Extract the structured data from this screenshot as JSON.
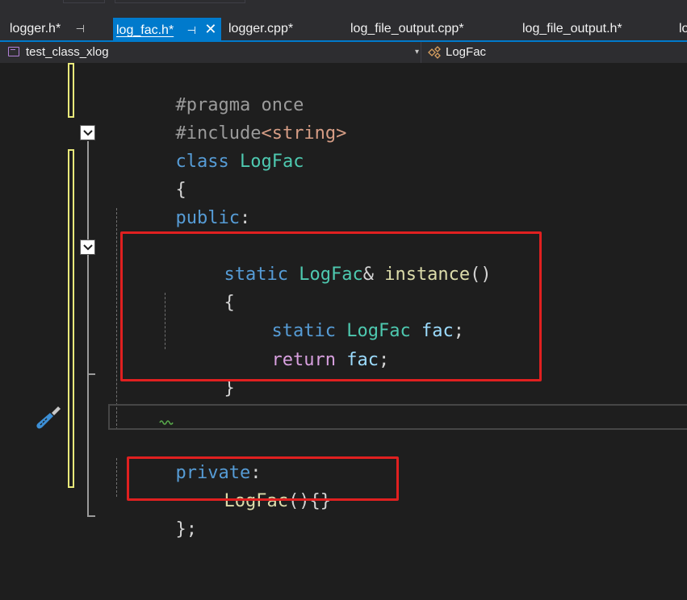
{
  "tabs": [
    {
      "label": "logger.h*",
      "pinned": true,
      "active": false
    },
    {
      "label": "log_fac.h*",
      "pinned": true,
      "active": true,
      "closable": true
    },
    {
      "label": "logger.cpp*",
      "active": false
    },
    {
      "label": "log_file_output.cpp*",
      "active": false
    },
    {
      "label": "log_file_output.h*",
      "active": false
    },
    {
      "label": "lo",
      "active": false
    }
  ],
  "icons": {
    "pin": "pin-icon",
    "close": "close-icon",
    "scope": "project-icon",
    "member": "class-icon",
    "fold": "collapse-icon",
    "tool": "screwdriver-icon"
  },
  "glyphs": {
    "pin": "⊣",
    "close": "✕",
    "dropdown": "▾"
  },
  "navbar": {
    "scope": "test_class_xlog",
    "member": "LogFac"
  },
  "code": {
    "l1": {
      "a": "#pragma once"
    },
    "l2": {
      "a": "#include",
      "b": "<string>"
    },
    "l3": {
      "a": "class",
      "b": "LogFac"
    },
    "l4": {
      "a": "{"
    },
    "l5": {
      "a": "public",
      "b": ":"
    },
    "l7": {
      "a": "static",
      "b": "LogFac",
      "c": "&",
      "d": "instance",
      "e": "()"
    },
    "l8": {
      "a": "{"
    },
    "l9": {
      "a": "static",
      "b": "LogFac",
      "c": "fac",
      "d": ";"
    },
    "l10": {
      "a": "return",
      "b": "fac",
      "c": ";"
    },
    "l11": {
      "a": "}"
    },
    "l14": {
      "a": "private",
      "b": ":"
    },
    "l15": {
      "a": "LogFac",
      "b": "(){}"
    },
    "l16": {
      "a": "};"
    }
  },
  "colors": {
    "accent": "#007acc",
    "keyword": "#569cd6",
    "type": "#4ec9b0",
    "function": "#dcdcaa",
    "control": "#d8a0df",
    "variable": "#9cdcfe",
    "string": "#d69d85",
    "annotation": "#e02020",
    "change-marker": "#e8e87a"
  }
}
